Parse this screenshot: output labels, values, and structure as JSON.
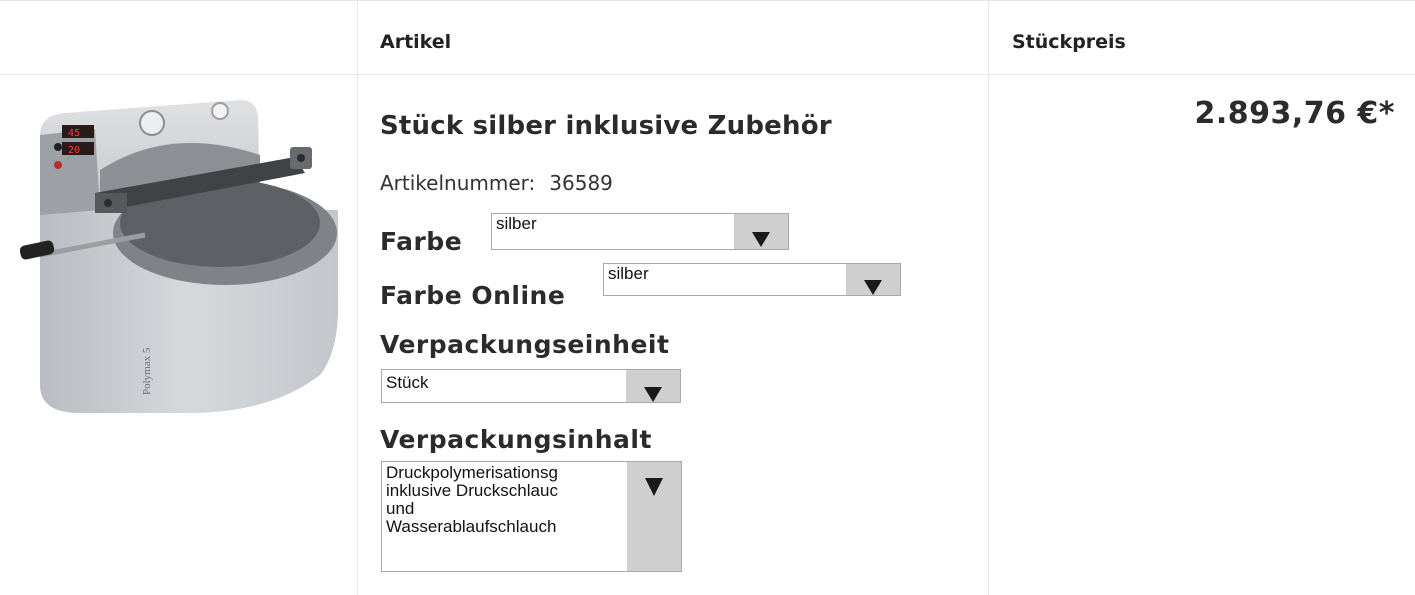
{
  "table": {
    "headers": {
      "article": "Artikel",
      "unit_price": "Stückpreis"
    }
  },
  "product": {
    "title": "Stück silber inklusive Zubehör",
    "article_number_label": "Artikelnummer:",
    "article_number": "36589",
    "image_text": "Polymax 5",
    "display_values": [
      "45",
      "20"
    ],
    "price": "2.893,76 €*",
    "options": {
      "farbe": {
        "label": "Farbe",
        "selected": "silber"
      },
      "farbe_online": {
        "label": "Farbe Online",
        "selected": "silber"
      },
      "verpackungseinheit": {
        "label": "Verpackungseinheit",
        "selected": "Stück"
      },
      "verpackungsinhalt": {
        "label": "Verpackungsinhalt",
        "selected_lines": [
          "Druckpolymerisationsg",
          "inklusive Druckschlauc",
          "und",
          "Wasserablaufschlauch"
        ]
      }
    }
  },
  "colors": {
    "border": "#e6e6e6",
    "select_arrow_bg": "#cfcfcf",
    "text": "#222222"
  },
  "icons": {
    "dropdown": "triangle-down-icon"
  }
}
